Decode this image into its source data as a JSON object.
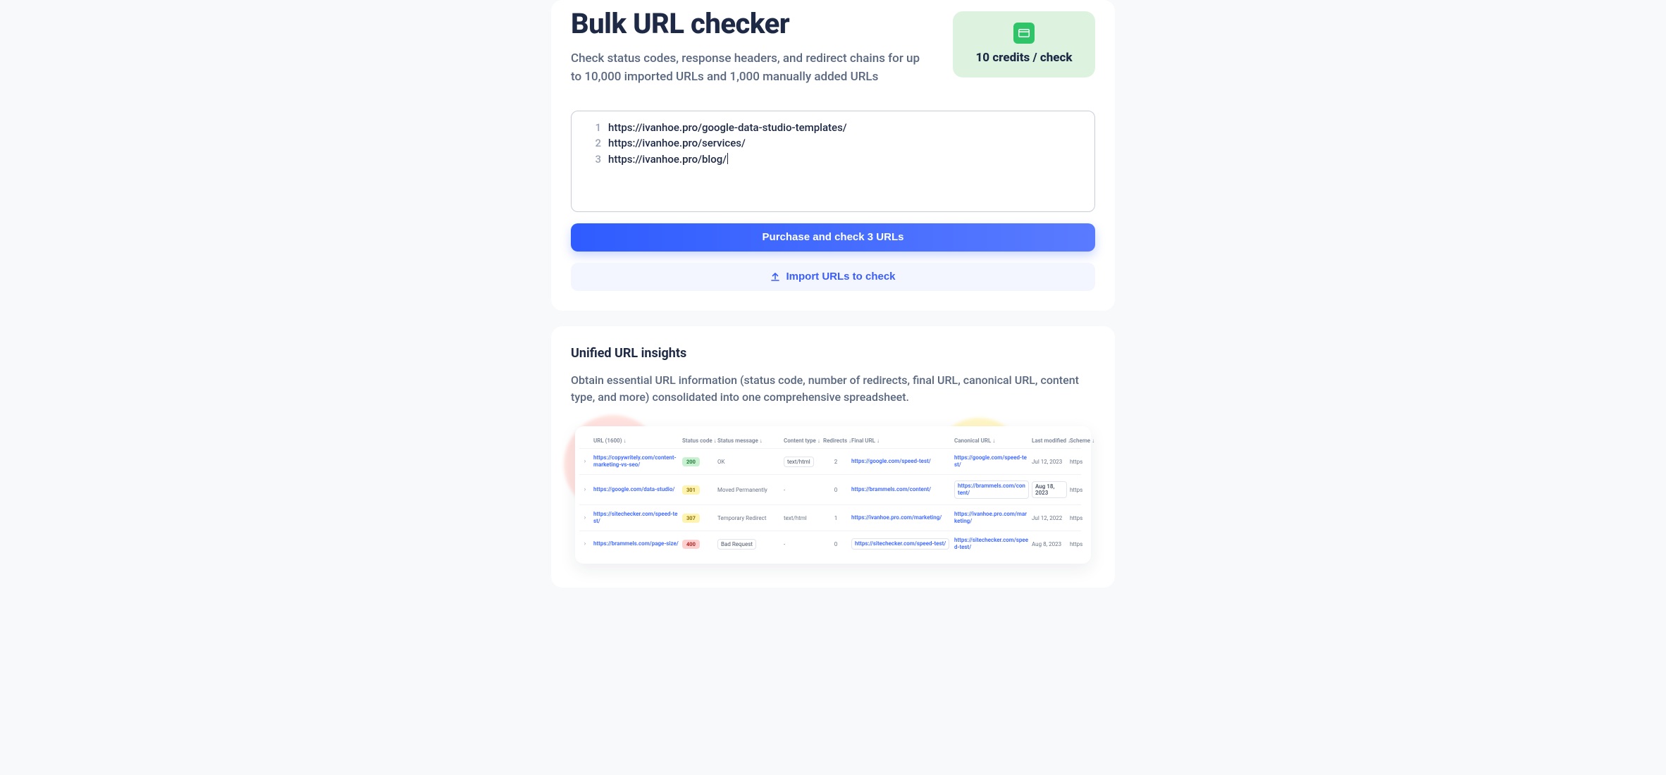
{
  "main": {
    "title": "Bulk URL checker",
    "subtitle": "Check status codes, response headers, and redirect chains for up to 10,000 imported URLs and 1,000 manually added URLs",
    "credits_label": "10 credits / check",
    "editor_lines": [
      {
        "n": "1",
        "text": "https://ivanhoe.pro/google-data-studio-templates/"
      },
      {
        "n": "2",
        "text": "https://ivanhoe.pro/services/"
      },
      {
        "n": "3",
        "text": "https://ivanhoe.pro/blog/"
      }
    ],
    "purchase_button": "Purchase and check 3 URLs",
    "import_button": "Import URLs to check"
  },
  "insights": {
    "title": "Unified URL insights",
    "desc": "Obtain essential URL information (status code, number of redirects, final URL, canonical URL, content type, and more) consolidated into one comprehensive spreadsheet.",
    "headers": {
      "url": "URL (1600) ↓",
      "status_code": "Status code ↓",
      "status_message": "Status message ↓",
      "content_type": "Content type ↓",
      "redirects": "Redirects ↓",
      "final_url": "Final URL ↓",
      "canonical_url": "Canonical URL ↓",
      "last_modified": "Last modified ↓",
      "scheme": "Scheme ↓"
    },
    "rows": [
      {
        "url": "https://copywritely.com/content-marketing-vs-seo/",
        "code": "200",
        "code_class": "b200",
        "message": "OK",
        "ctype": "text/html",
        "ctype_boxed": true,
        "redirects": "2",
        "final": "https://google.com/speed-test/",
        "final_boxed": false,
        "canonical": "https://google.com/speed-test/",
        "canonical_boxed": false,
        "modified": "Jul 12, 2023",
        "mod_boxed": false,
        "scheme": "https"
      },
      {
        "url": "https://google.com/data-studio/",
        "code": "301",
        "code_class": "b301",
        "message": "Moved Permanently",
        "ctype": "-",
        "ctype_boxed": false,
        "redirects": "0",
        "final": "https://brammels.com/content/",
        "final_boxed": false,
        "canonical": "https://brammels.com/content/",
        "canonical_boxed": true,
        "modified": "Aug 18, 2023",
        "mod_boxed": true,
        "scheme": "https"
      },
      {
        "url": "https://sitechecker.com/speed-test/",
        "code": "307",
        "code_class": "b307",
        "message": "Temporary Redirect",
        "ctype": "text/html",
        "ctype_boxed": false,
        "redirects": "1",
        "final": "https://ivanhoe.pro.com/marketing/",
        "final_boxed": false,
        "canonical": "https://ivanhoe.pro.com/marketing/",
        "canonical_boxed": false,
        "modified": "Jul 12, 2022",
        "mod_boxed": false,
        "scheme": "https"
      },
      {
        "url": "https://brammels.com/page-size/",
        "code": "400",
        "code_class": "b400",
        "message": "Bad Request",
        "ctype": "-",
        "ctype_boxed": false,
        "redirects": "0",
        "final": "https://sitechecker.com/speed-test/",
        "final_boxed": true,
        "canonical": "https://sitechecker.com/speed-test/",
        "canonical_boxed": false,
        "modified": "Aug 8, 2023",
        "mod_boxed": false,
        "scheme": "https"
      }
    ]
  }
}
